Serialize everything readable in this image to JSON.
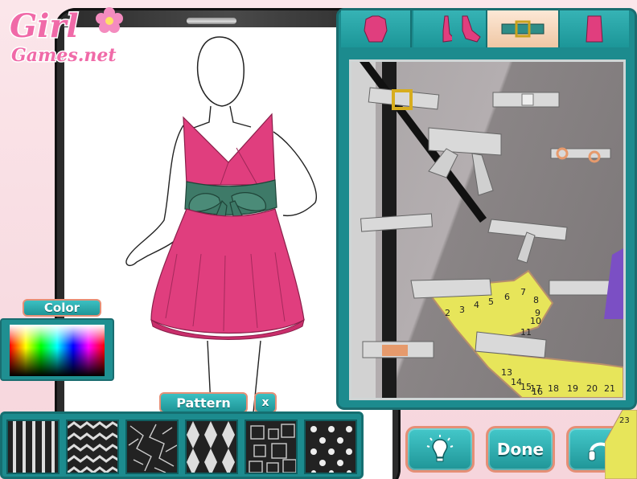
{
  "logo": {
    "line1": "Girl",
    "line2": "Games.net"
  },
  "tabs": [
    {
      "name": "tops"
    },
    {
      "name": "shoes-left"
    },
    {
      "name": "shoes-right"
    },
    {
      "name": "belts",
      "active": true
    },
    {
      "name": "skirts"
    }
  ],
  "color_panel": {
    "label": "Color"
  },
  "pattern_panel": {
    "label": "Pattern",
    "close_label": "x"
  },
  "patterns": [
    "stripes",
    "zigzag",
    "cracks",
    "harlequin",
    "squares",
    "polka-dots"
  ],
  "buttons": {
    "done_label": "Done"
  },
  "tape_numbers": [
    "2",
    "3",
    "4",
    "5",
    "6",
    "7",
    "8",
    "9",
    "10",
    "11",
    "13",
    "14",
    "15",
    "16",
    "17",
    "18",
    "19",
    "20",
    "21"
  ],
  "corner_number": "23",
  "colors": {
    "dress": "#e03e7e",
    "belt": "#3e7a68",
    "panel": "#1c8b8e",
    "accent": "#e58f76"
  }
}
